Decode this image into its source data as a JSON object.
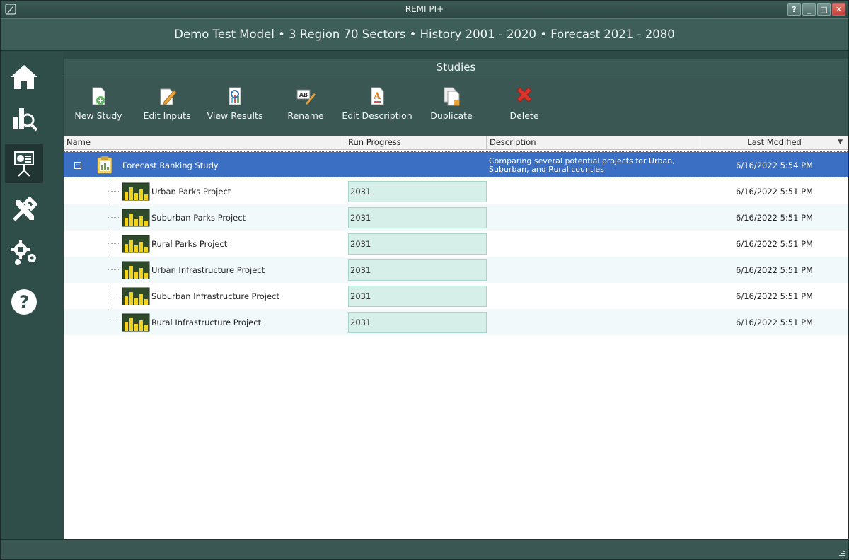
{
  "window": {
    "title": "REMI PI+",
    "buttons": {
      "help": "?",
      "minimize": "_",
      "maximize": "□",
      "close": "✕"
    }
  },
  "model_header": "Demo Test Model • 3 Region 70 Sectors • History 2001 - 2020 • Forecast 2021 - 2080",
  "nav": {
    "items": [
      {
        "icon": "home-icon",
        "active": false
      },
      {
        "icon": "chart-magnifier-icon",
        "active": false
      },
      {
        "icon": "presentation-icon",
        "active": true
      },
      {
        "icon": "tools-icon",
        "active": false
      },
      {
        "icon": "gears-icon",
        "active": false
      },
      {
        "icon": "help-icon",
        "active": false
      }
    ]
  },
  "studies": {
    "header": "Studies",
    "toolbar": {
      "new_study": "New Study",
      "edit_inputs": "Edit Inputs",
      "view_results": "View Results",
      "rename": "Rename",
      "edit_description": "Edit Description",
      "duplicate": "Duplicate",
      "delete": "Delete"
    },
    "columns": {
      "name": "Name",
      "run_progress": "Run Progress",
      "description": "Description",
      "last_modified": "Last Modified"
    },
    "parent": {
      "expander": "−",
      "name": "Forecast Ranking Study",
      "description": "Comparing several potential projects for Urban, Suburban, and Rural counties",
      "last_modified": "6/16/2022 5:54 PM"
    },
    "children": [
      {
        "name": "Urban Parks Project",
        "run_progress": "2031",
        "last_modified": "6/16/2022 5:51 PM"
      },
      {
        "name": "Suburban Parks Project",
        "run_progress": "2031",
        "last_modified": "6/16/2022 5:51 PM"
      },
      {
        "name": "Rural Parks Project",
        "run_progress": "2031",
        "last_modified": "6/16/2022 5:51 PM"
      },
      {
        "name": "Urban Infrastructure Project",
        "run_progress": "2031",
        "last_modified": "6/16/2022 5:51 PM"
      },
      {
        "name": "Suburban Infrastructure Project",
        "run_progress": "2031",
        "last_modified": "6/16/2022 5:51 PM"
      },
      {
        "name": "Rural Infrastructure Project",
        "run_progress": "2031",
        "last_modified": "6/16/2022 5:51 PM"
      }
    ]
  },
  "colors": {
    "chrome": "#2e4a46",
    "selection": "#3a6fc4",
    "progress_fill": "#d7efe9",
    "delete_red": "#d9352a"
  }
}
